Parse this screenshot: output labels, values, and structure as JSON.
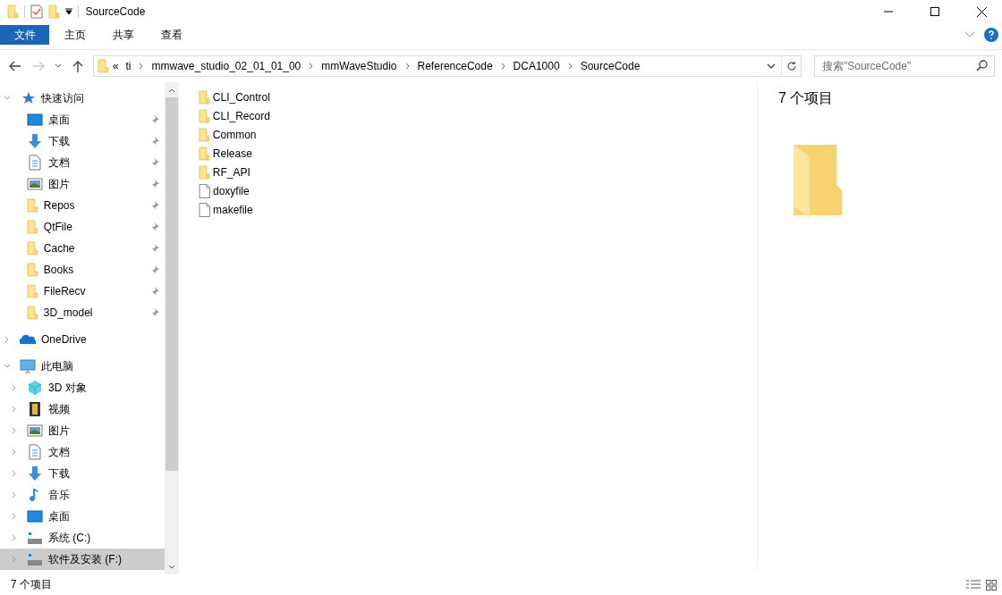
{
  "window": {
    "title": "SourceCode"
  },
  "ribbon": {
    "tabs": [
      {
        "kind": "file",
        "label": "文件"
      },
      {
        "kind": "tab",
        "label": "主页"
      },
      {
        "kind": "tab",
        "label": "共享"
      },
      {
        "kind": "tab",
        "label": "查看"
      }
    ]
  },
  "address_bar": {
    "forward_disabled": true,
    "overflow": "«",
    "path": [
      "ti",
      "mmwave_studio_02_01_01_00",
      "mmWaveStudio",
      "ReferenceCode",
      "DCA1000",
      "SourceCode"
    ]
  },
  "search": {
    "placeholder": "搜索\"SourceCode\""
  },
  "sidebar": {
    "items": [
      {
        "kind": "star",
        "label": "快速访问",
        "expanded": true,
        "selected": false,
        "children": [
          {
            "kind": "desktop",
            "label": "桌面",
            "pinned": true,
            "selected": false
          },
          {
            "kind": "download",
            "label": "下载",
            "pinned": true,
            "selected": false
          },
          {
            "kind": "document",
            "label": "文档",
            "pinned": true,
            "selected": false
          },
          {
            "kind": "picture",
            "label": "图片",
            "pinned": true,
            "selected": false
          },
          {
            "kind": "folder",
            "label": "Repos",
            "pinned": true,
            "selected": false
          },
          {
            "kind": "folder",
            "label": "QtFile",
            "pinned": true,
            "selected": false
          },
          {
            "kind": "folder",
            "label": "Cache",
            "pinned": true,
            "selected": false
          },
          {
            "kind": "folder",
            "label": "Books",
            "pinned": true,
            "selected": false
          },
          {
            "kind": "folder",
            "label": "FileRecv",
            "pinned": true,
            "selected": false
          },
          {
            "kind": "folder",
            "label": "3D_model",
            "pinned": true,
            "selected": false
          }
        ]
      },
      {
        "kind": "cloud",
        "label": "OneDrive",
        "expanded": false,
        "selected": false
      },
      {
        "kind": "pc",
        "label": "此电脑",
        "expanded": true,
        "selected": false,
        "children": [
          {
            "kind": "cube",
            "label": "3D 对象",
            "expanded": false,
            "selected": false
          },
          {
            "kind": "video",
            "label": "视频",
            "expanded": false,
            "selected": false
          },
          {
            "kind": "picture",
            "label": "图片",
            "expanded": false,
            "selected": false
          },
          {
            "kind": "document",
            "label": "文档",
            "expanded": false,
            "selected": false
          },
          {
            "kind": "download",
            "label": "下载",
            "expanded": false,
            "selected": false
          },
          {
            "kind": "music",
            "label": "音乐",
            "expanded": false,
            "selected": false
          },
          {
            "kind": "desktop",
            "label": "桌面",
            "expanded": false,
            "selected": false
          },
          {
            "kind": "drive",
            "label": "系统 (C:)",
            "expanded": false,
            "selected": false
          },
          {
            "kind": "drive",
            "label": "软件及安装 (F:)",
            "expanded": false,
            "selected": true
          }
        ]
      }
    ]
  },
  "files": [
    {
      "kind": "folder",
      "name": "CLI_Control"
    },
    {
      "kind": "folder",
      "name": "CLI_Record"
    },
    {
      "kind": "folder",
      "name": "Common"
    },
    {
      "kind": "folder",
      "name": "Release"
    },
    {
      "kind": "folder",
      "name": "RF_API"
    },
    {
      "kind": "file",
      "name": "doxyfile"
    },
    {
      "kind": "file",
      "name": "makefile"
    }
  ],
  "details_pane": {
    "summary": "7 个项目"
  },
  "status_bar": {
    "count": "7 个项目"
  }
}
